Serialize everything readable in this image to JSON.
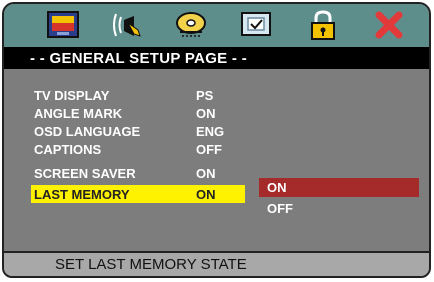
{
  "toolbar": {
    "icons": [
      "picture-icon",
      "speaker-icon",
      "disc-icon",
      "video-settings-icon",
      "lock-icon",
      "close-icon"
    ],
    "colors": {
      "bg": "#5e8e8b",
      "close": "#e23a3a",
      "lock": "#f3c200"
    }
  },
  "header": {
    "title": "- - GENERAL SETUP PAGE - -"
  },
  "menu": {
    "items": [
      {
        "label": "TV DISPLAY",
        "value": "PS"
      },
      {
        "label": "ANGLE MARK",
        "value": "ON"
      },
      {
        "label": "OSD LANGUAGE",
        "value": "ENG"
      },
      {
        "label": "CAPTIONS",
        "value": "OFF"
      },
      {
        "label": "SCREEN SAVER",
        "value": "ON"
      },
      {
        "label": "LAST MEMORY",
        "value": "ON"
      }
    ],
    "selected_color": "#fff200"
  },
  "options": {
    "items": [
      "ON",
      "OFF"
    ],
    "active_color": "#a52a2a"
  },
  "footer": {
    "text": "SET LAST MEMORY STATE"
  }
}
